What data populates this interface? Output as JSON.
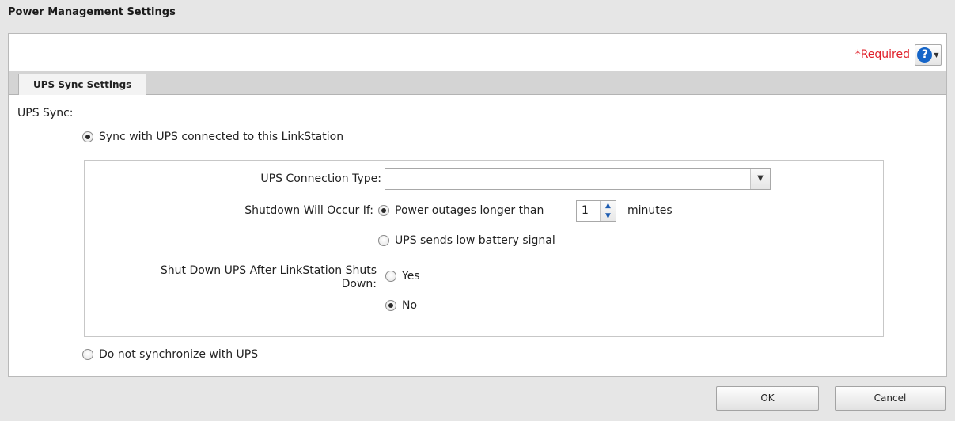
{
  "window": {
    "title": "Power Management Settings"
  },
  "header": {
    "required_label": "*Required",
    "help_icon": "help-icon"
  },
  "tabs": [
    {
      "label": "UPS Sync Settings"
    }
  ],
  "ups_sync": {
    "label": "UPS Sync:",
    "option_sync": "Sync with UPS connected to this LinkStation",
    "option_no_sync": "Do not synchronize with UPS",
    "selected": "sync"
  },
  "connection_type": {
    "label": "UPS Connection Type:",
    "value": ""
  },
  "shutdown_condition": {
    "label": "Shutdown Will Occur If:",
    "option_outage": "Power outages longer than",
    "minutes_value": "1",
    "minutes_unit": "minutes",
    "option_low_battery": "UPS sends low battery signal",
    "selected": "outage"
  },
  "shutdown_ups": {
    "label_line1": "Shut Down UPS After LinkStation Shuts",
    "label_line2": "Down:",
    "option_yes": "Yes",
    "option_no": "No",
    "selected": "no"
  },
  "footer": {
    "ok_label": "OK",
    "cancel_label": "Cancel"
  },
  "colors": {
    "required": "#e0202a",
    "help": "#1565c8",
    "spinner_arrow": "#1c5bb0"
  }
}
